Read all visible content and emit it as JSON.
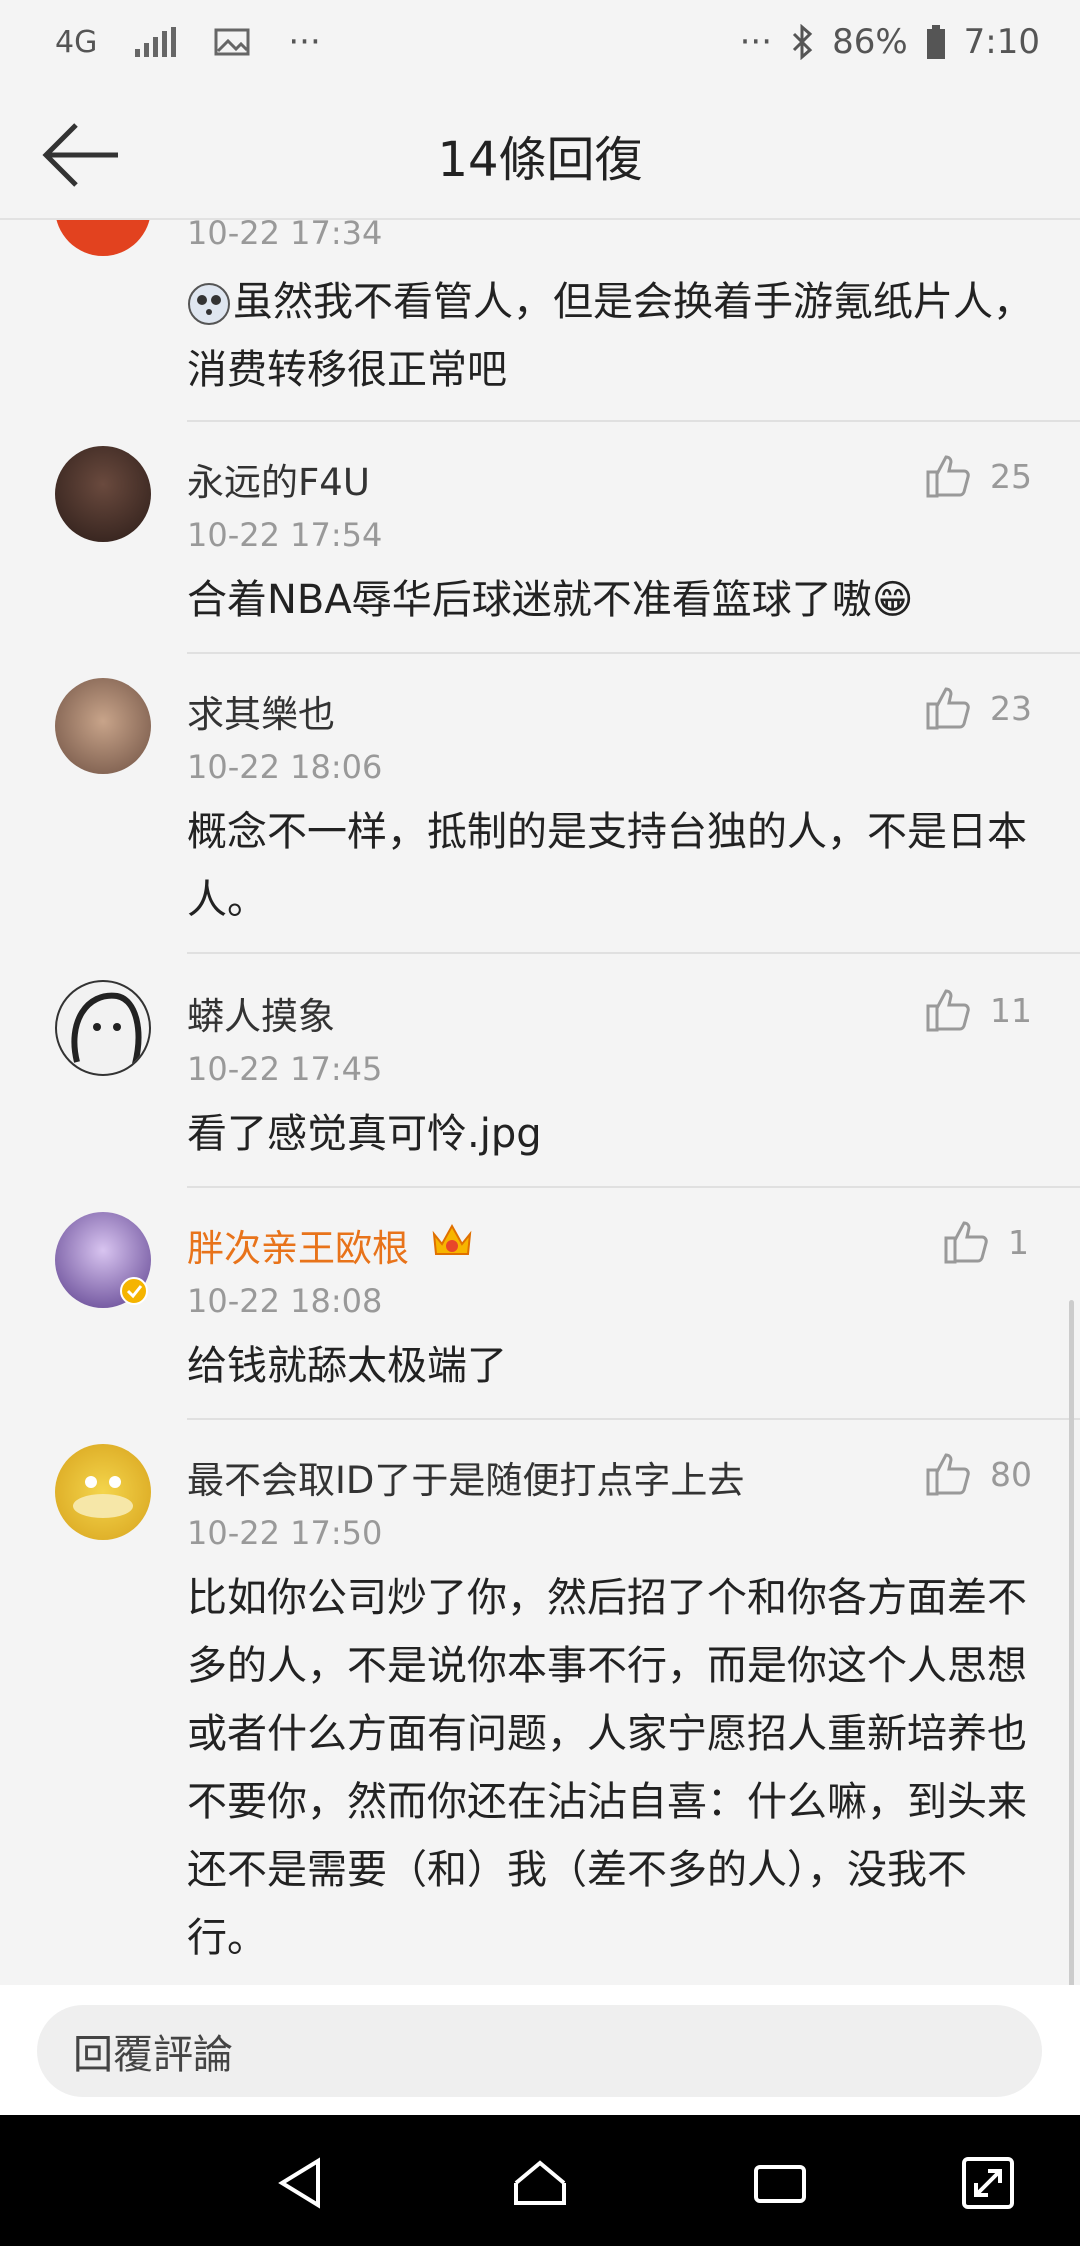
{
  "status": {
    "network": "4G",
    "battery": "86%",
    "time": "7:10",
    "dots_left": "···",
    "dots_right": "···"
  },
  "header": {
    "title": "14條回復"
  },
  "comments": [
    {
      "name": "",
      "time": "10-22 17:34",
      "text": "虽然我不看管人，但是会换着手游氪纸片人，消费转移很正常吧",
      "likes": ""
    },
    {
      "name": "永远的F4U",
      "time": "10-22 17:54",
      "text": "合着NBA辱华后球迷就不准看篮球了嗷😁",
      "likes": "25"
    },
    {
      "name": "求其樂也",
      "time": "10-22 18:06",
      "text": "概念不一样，抵制的是支持台独的人，不是日本人。",
      "likes": "23"
    },
    {
      "name": "蟒人摸象",
      "time": "10-22 17:45",
      "text": "看了感觉真可怜.jpg",
      "likes": "11"
    },
    {
      "name": "胖次亲王欧根",
      "time": "10-22 18:08",
      "text": "给钱就舔太极端了",
      "likes": "1"
    },
    {
      "name": "最不会取ID了于是随便打点字上去",
      "time": "10-22 17:50",
      "text": "比如你公司炒了你，然后招了个和你各方面差不多的人，不是说你本事不行，而是你这个人思想或者什么方面有问题，人家宁愿招人重新培养也不要你，然而你还在沾沾自喜：什么嘛，到头来还不是需要（和）我（差不多的人），没我不行。",
      "likes": "80"
    }
  ],
  "reply": {
    "placeholder": "回覆評論"
  }
}
